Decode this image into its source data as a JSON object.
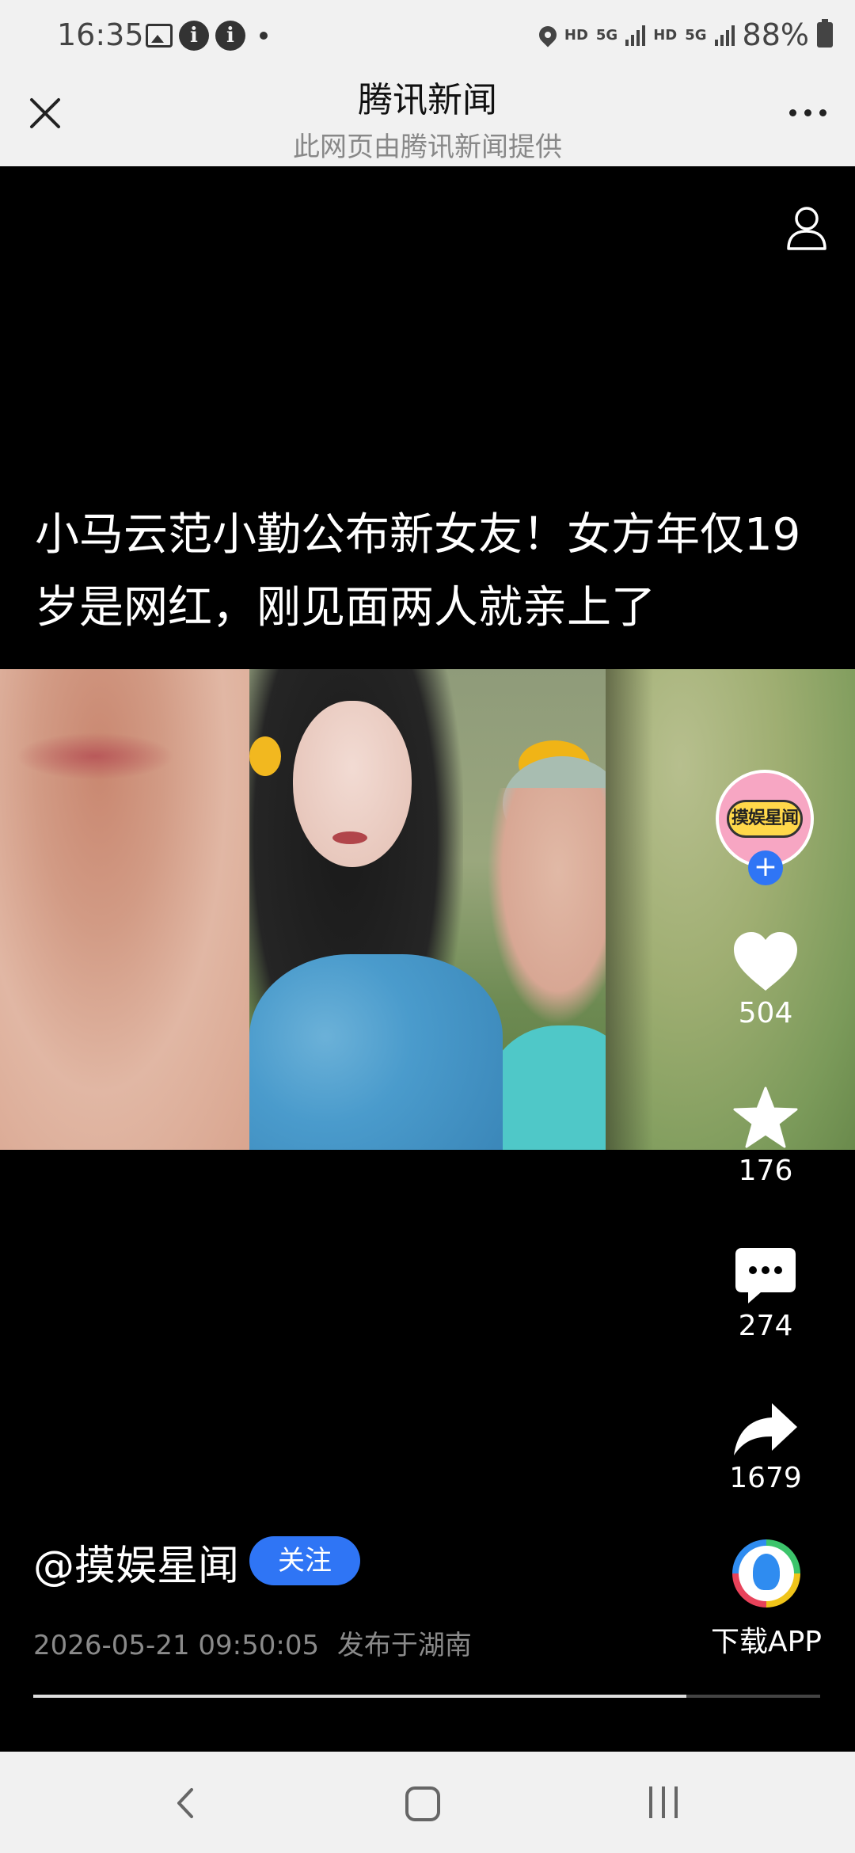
{
  "status_bar": {
    "time": "16:35",
    "hd1": "HD",
    "net1": "5G",
    "hd2": "HD",
    "net2": "5G",
    "battery": "88%",
    "icons": [
      "gallery-icon",
      "info-icon",
      "info-icon",
      "dot-icon",
      "location-icon",
      "signal-icon",
      "signal-icon",
      "battery-icon"
    ]
  },
  "titlebar": {
    "title": "腾讯新闻",
    "subtitle": "此网页由腾讯新闻提供"
  },
  "article": {
    "headline": "小马云范小勤公布新女友！女方年仅19岁是网红，刚见面两人就亲上了"
  },
  "channel": {
    "avatar_text": "摸娱星闻",
    "author": "@摸娱星闻",
    "follow_label": "关注",
    "date": "2026-05-21 09:50:05",
    "location": "发布于湖南"
  },
  "actions": {
    "likes": "504",
    "favorites": "176",
    "comments": "274",
    "shares": "1679",
    "download_label": "下载APP"
  },
  "progress": {
    "played_fraction": 0.83
  },
  "colors": {
    "accent": "#2f75f5",
    "background": "#000000",
    "bar": "#f1f1f1"
  }
}
